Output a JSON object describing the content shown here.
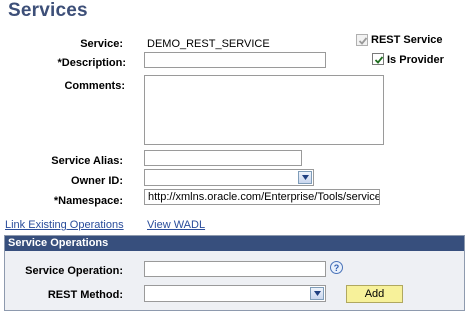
{
  "page": {
    "title": "Services"
  },
  "form": {
    "service_label": "Service:",
    "service_value": "DEMO_REST_SERVICE",
    "description_label": "*Description:",
    "description_value": "",
    "comments_label": "Comments:",
    "comments_value": "",
    "alias_label": "Service Alias:",
    "alias_value": "",
    "owner_label": "Owner ID:",
    "owner_value": "",
    "namespace_label": "*Namespace:",
    "namespace_value": "http://xmlns.oracle.com/Enterprise/Tools/services",
    "rest_service_label": "REST Service",
    "rest_service_checked": true,
    "is_provider_label": "Is Provider",
    "is_provider_checked": true
  },
  "links": {
    "link_existing": "Link Existing Operations",
    "view_wadl": "View WADL"
  },
  "operations": {
    "header": "Service Operations",
    "operation_label": "Service Operation:",
    "operation_value": "",
    "method_label": "REST Method:",
    "method_value": "",
    "help_glyph": "?",
    "add_label": "Add"
  },
  "icons": {
    "dropdown": "chevron-down-icon",
    "help": "question-icon",
    "checkmark": "checkmark-icon"
  },
  "colors": {
    "title": "#3d4f78",
    "section_header": "#374f7d",
    "link": "#2a4d9b",
    "add_button": "#f7f19a"
  }
}
